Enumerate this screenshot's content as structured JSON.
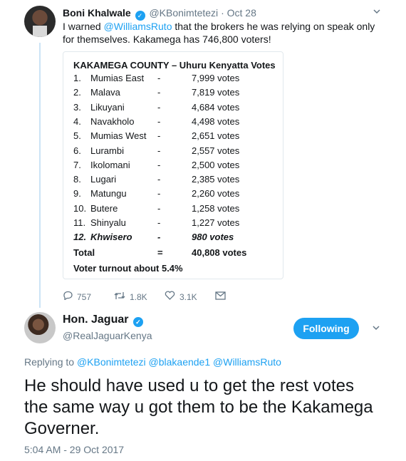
{
  "parent_tweet": {
    "name": "Boni Khalwale",
    "handle": "@KBonimtetezi",
    "time": "Oct 28",
    "text_parts": [
      "I warned ",
      "@WilliamsRuto",
      " that the brokers he was relying on speak only for themselves. Kakamega has 746,800 voters!"
    ],
    "image_table": {
      "title": "KAKAMEGA COUNTY – Uhuru Kenyatta Votes",
      "rows": [
        {
          "num": "1.",
          "place": "Mumias East",
          "dash": "-",
          "votes": "7,999 votes"
        },
        {
          "num": "2.",
          "place": "Malava",
          "dash": "-",
          "votes": "7,819 votes"
        },
        {
          "num": "3.",
          "place": "Likuyani",
          "dash": "-",
          "votes": "4,684 votes"
        },
        {
          "num": "4.",
          "place": "Navakholo",
          "dash": "-",
          "votes": "4,498 votes"
        },
        {
          "num": "5.",
          "place": "Mumias West",
          "dash": "-",
          "votes": "2,651 votes"
        },
        {
          "num": "6.",
          "place": "Lurambi",
          "dash": "-",
          "votes": "2,557 votes"
        },
        {
          "num": "7.",
          "place": "Ikolomani",
          "dash": "-",
          "votes": "2,500 votes"
        },
        {
          "num": "8.",
          "place": "Lugari",
          "dash": "-",
          "votes": "2,385 votes"
        },
        {
          "num": "9.",
          "place": "Matungu",
          "dash": "-",
          "votes": "2,260 votes"
        },
        {
          "num": "10.",
          "place": "Butere",
          "dash": "-",
          "votes": "1,258 votes"
        },
        {
          "num": "11.",
          "place": "Shinyalu",
          "dash": "-",
          "votes": "1,227 votes"
        },
        {
          "num": "12.",
          "place": "Khwisero",
          "dash": "-",
          "votes": "980 votes"
        }
      ],
      "total": {
        "label": "Total",
        "sign": "=",
        "votes": "40,808 votes"
      },
      "turnout": "Voter turnout about 5.4%"
    },
    "actions": {
      "replies": "757",
      "retweets": "1.8K",
      "likes": "3.1K"
    }
  },
  "main_tweet": {
    "name": "Hon. Jaguar",
    "handle": "@RealJaguarKenya",
    "follow_label": "Following",
    "reply_prefix": "Replying to",
    "reply_mentions": "@KBonimtetezi @blakaende1 @WilliamsRuto",
    "text": "He should have used u to get the rest votes the same way u got them to be the Kakamega Governer.",
    "timestamp": "5:04 AM - 29 Oct 2017"
  },
  "icons": {
    "reply": "reply-icon",
    "retweet": "retweet-icon",
    "like": "heart-icon",
    "message": "envelope-icon",
    "verified": "verified-badge-icon",
    "caret": "chevron-down-icon"
  },
  "colors": {
    "accent": "#1da1f2",
    "muted": "#657786",
    "thread": "#cce4f6"
  }
}
